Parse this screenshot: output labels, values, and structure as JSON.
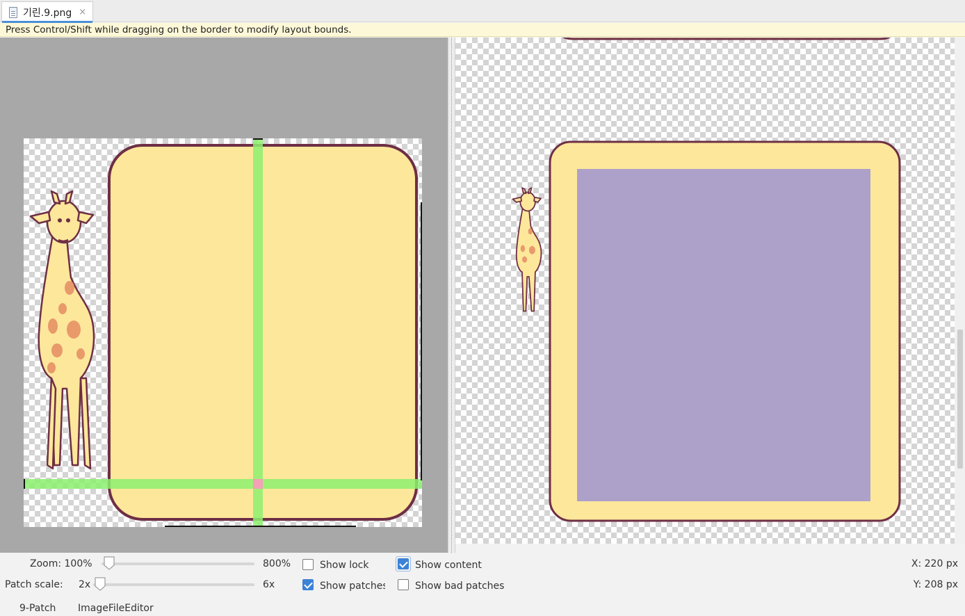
{
  "tab": {
    "title": "기린.9.png",
    "close": "×"
  },
  "hint": "Press Control/Shift while dragging on the border to modify layout bounds.",
  "controls": {
    "zoom_label": "Zoom: 100%",
    "zoom_max": "800%",
    "patch_scale_label": "Patch scale:",
    "patch_min": "2x",
    "patch_max": "6x",
    "show_lock": "Show lock",
    "show_patches": "Show patches",
    "show_content": "Show content",
    "show_bad_patches": "Show bad patches",
    "zoom_value": 0.0,
    "patch_scale_value": 0.0,
    "show_lock_checked": false,
    "show_patches_checked": true,
    "show_content_checked": true,
    "show_bad_patches_checked": false,
    "coord_x": "X: 220 px",
    "coord_y": "Y: 208 px"
  },
  "bottom_tabs": [
    "9-Patch",
    "ImageFileEditor"
  ],
  "colors": {
    "panel_fill": "#fde79b",
    "panel_stroke": "#6e2f45",
    "patch_green": "#8cf06e",
    "patch_pink": "#f4a0b6",
    "content_purple": "#ada1ca"
  }
}
